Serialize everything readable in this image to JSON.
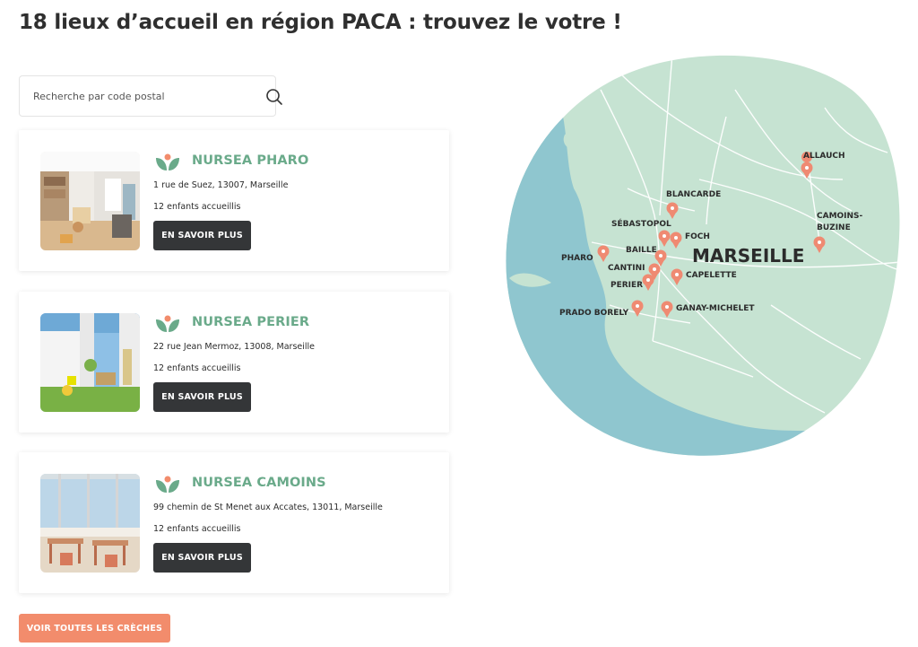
{
  "page": {
    "title": "18 lieux d’accueil en région PACA : trouvez le votre !"
  },
  "search": {
    "placeholder": "Recherche par code postal",
    "icon": "search-icon"
  },
  "cards": [
    {
      "name": "NURSEA PHARO",
      "address": "1 rue de Suez, 13007, Marseille",
      "capacity": "12 enfants accueillis",
      "button_label": "EN SAVOIR PLUS"
    },
    {
      "name": "NURSEA PERIER",
      "address": "22 rue Jean Mermoz, 13008, Marseille",
      "capacity": "12 enfants accueillis",
      "button_label": "EN SAVOIR PLUS"
    },
    {
      "name": "NURSEA CAMOINS",
      "address": "99 chemin de St Menet aux Accates, 13011, Marseille",
      "capacity": "12 enfants accueillis",
      "button_label": "EN SAVOIR PLUS"
    }
  ],
  "see_all_label": "VOIR TOUTES LES CRÈCHES",
  "map": {
    "city_label": "MARSEILLE",
    "locations": [
      "ALLAUCH",
      "BLANCARDE",
      "CAMOINS-",
      "BUZINE",
      "SÉBASTOPOL",
      "FOCH",
      "BAILLE",
      "PHARO",
      "CANTINI",
      "CAPELETTE",
      "PERIER",
      "PRADO BORELY",
      "GANAY-MICHELET"
    ]
  },
  "colors": {
    "brand_green": "#6aaa8a",
    "dark_button": "#343638",
    "accent_coral": "#f28c6c",
    "map_land": "#c6e3d2",
    "map_sea": "#8fc6cf",
    "marker": "#ef8a72"
  }
}
